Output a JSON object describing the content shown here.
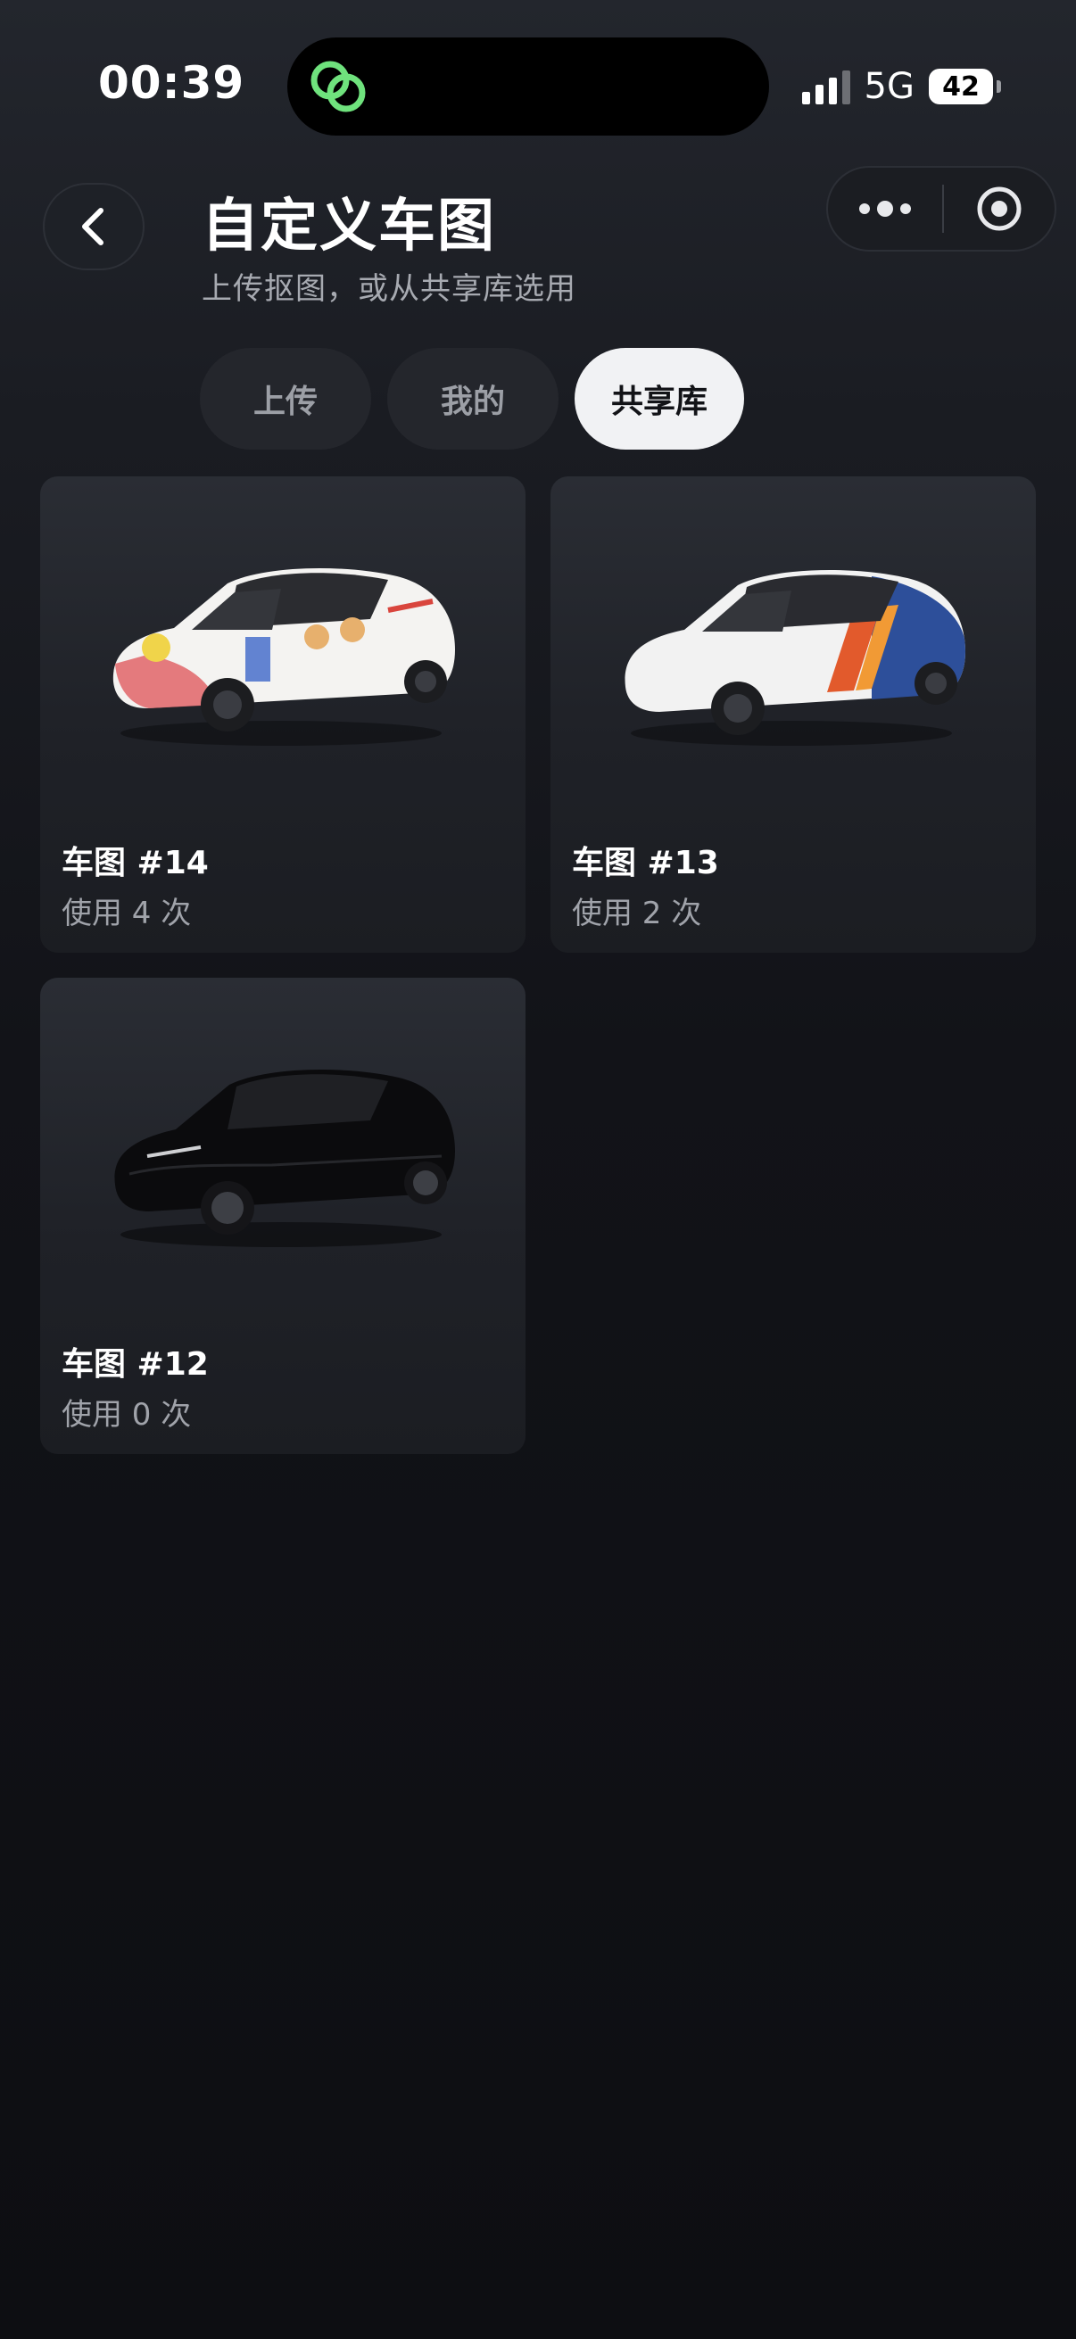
{
  "status_bar": {
    "time": "00:39",
    "network": "5G",
    "battery": "42",
    "island_icon": "link-rings-icon",
    "island_color": "#6fe27d"
  },
  "header": {
    "title": "自定义车图",
    "subtitle": "上传抠图，或从共享库选用",
    "back_icon": "chevron-left-icon",
    "more_icon": "more-dots-icon",
    "target_icon": "target-circle-icon"
  },
  "tabs": [
    {
      "label": "上传",
      "active": false
    },
    {
      "label": "我的",
      "active": false
    },
    {
      "label": "共享库",
      "active": true
    }
  ],
  "cards": [
    {
      "title": "车图 #14",
      "usage": "使用 4 次",
      "image": "car-doodle-wrap-icon"
    },
    {
      "title": "车图 #13",
      "usage": "使用 2 次",
      "image": "car-white-stripe-icon"
    },
    {
      "title": "车图 #12",
      "usage": "使用 0 次",
      "image": "car-black-icon"
    }
  ],
  "colors": {
    "background": "#121318",
    "card": "#23252b",
    "active_tab": "#f1f2f4",
    "inactive_tab": "#24262c"
  }
}
